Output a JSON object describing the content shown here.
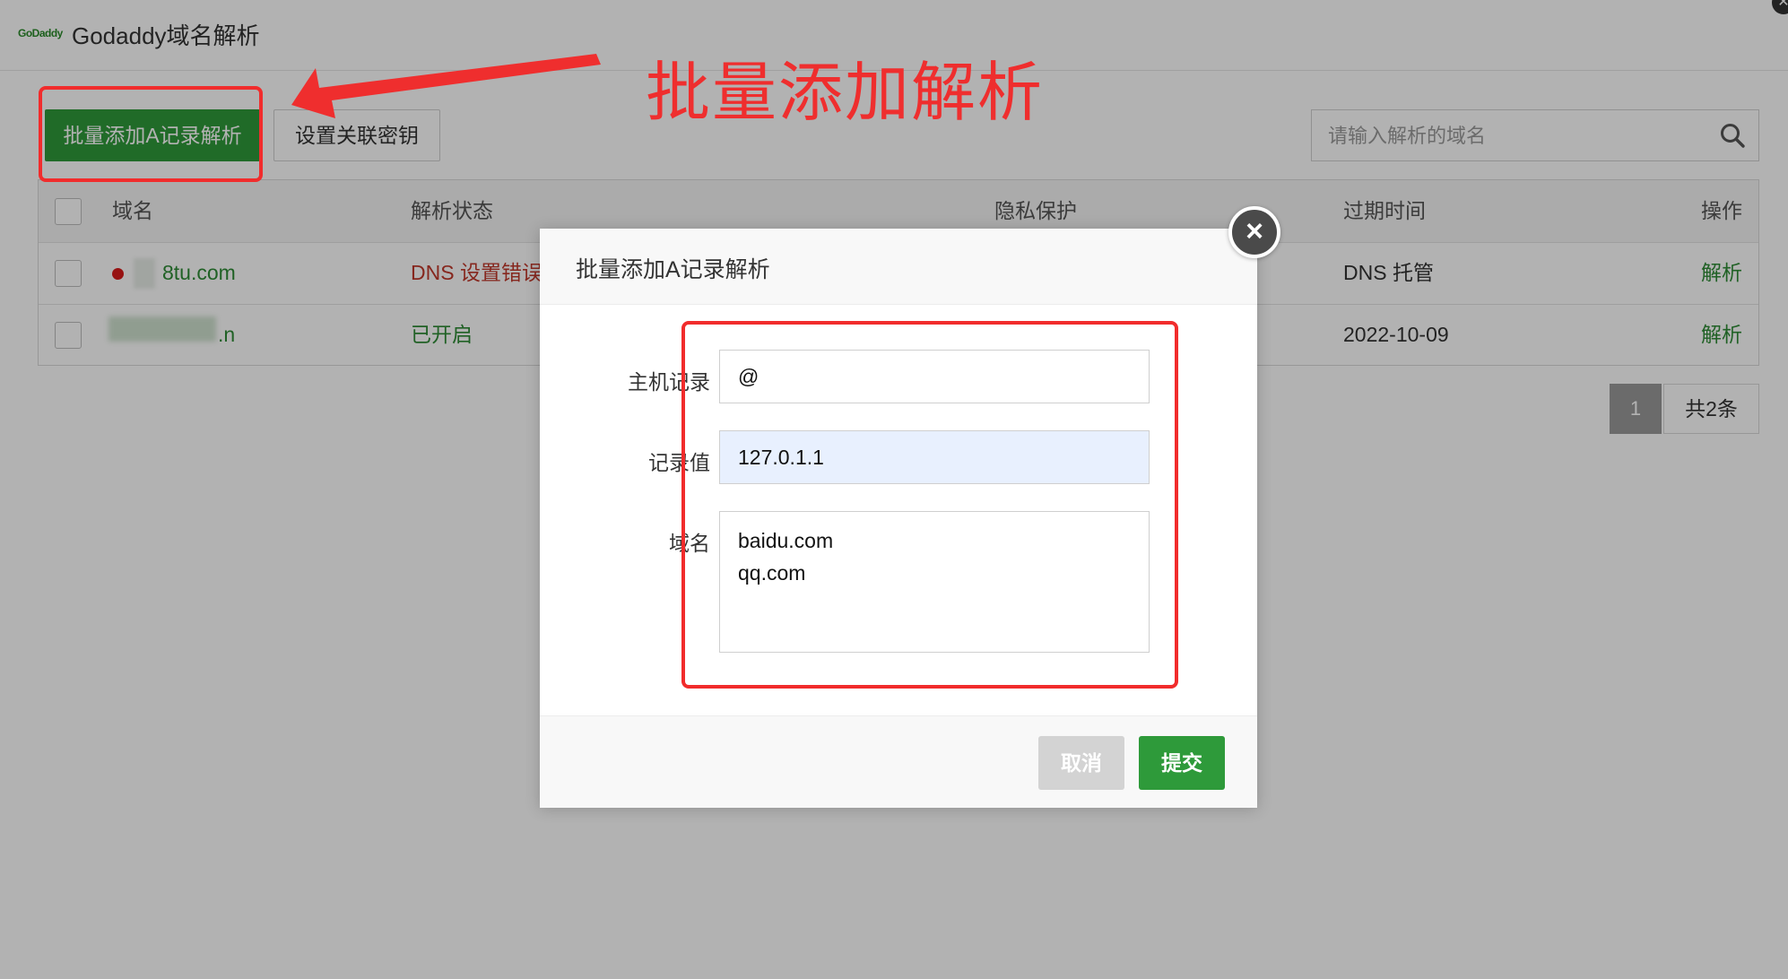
{
  "header": {
    "logo_text": "GoDaddy",
    "title": "Godaddy域名解析"
  },
  "toolbar": {
    "batch_add_label": "批量添加A记录解析",
    "set_key_label": "设置关联密钥",
    "search_placeholder": "请输入解析的域名"
  },
  "table": {
    "headers": [
      "域名",
      "解析状态",
      "隐私保护",
      "过期时间",
      "操作"
    ],
    "rows": [
      {
        "domain": "8tu.com",
        "status": "DNS 设置错误",
        "expiry": "DNS 托管",
        "action": "解析"
      },
      {
        "domain": ".n",
        "status": "已开启",
        "expiry": "2022-10-09",
        "action": "解析"
      }
    ]
  },
  "pagination": {
    "current_page": "1",
    "total_label": "共2条"
  },
  "modal": {
    "title": "批量添加A记录解析",
    "host_label": "主机记录",
    "host_value": "@",
    "value_label": "记录值",
    "value_value": "127.0.1.1",
    "domains_label": "域名",
    "domains_lines": [
      "baidu.com",
      "qq.com"
    ],
    "cancel_label": "取消",
    "submit_label": "提交"
  },
  "annotation": {
    "text": "批量添加解析"
  },
  "colors": {
    "brand_green": "#2e9a3a",
    "annotation_red": "#ef2e2e",
    "error_red": "#c0392b",
    "link_green": "#2e8b35"
  }
}
